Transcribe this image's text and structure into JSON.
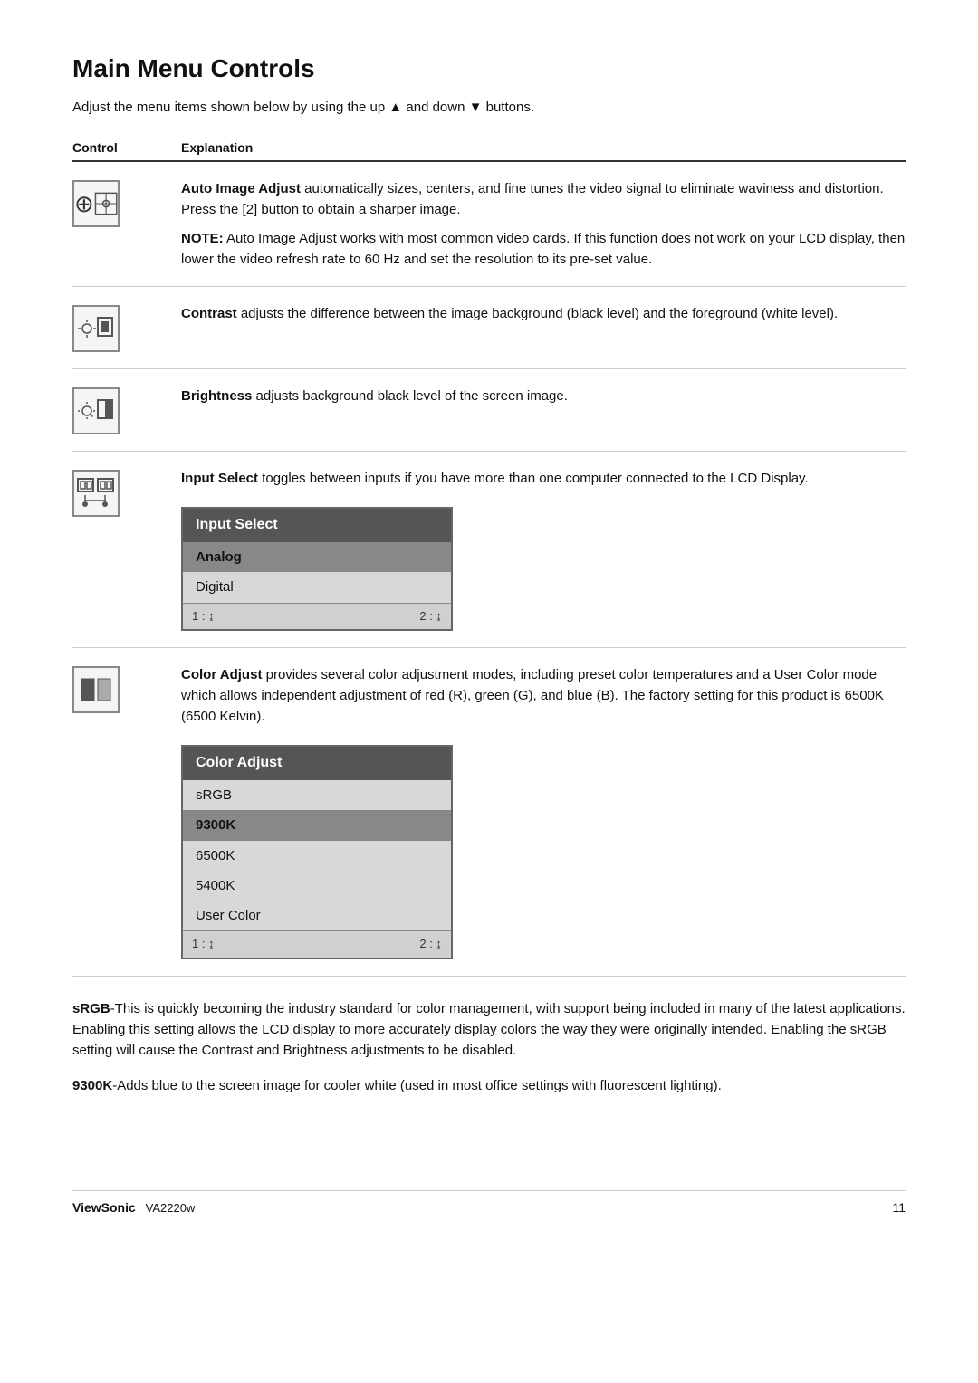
{
  "page": {
    "title": "Main Menu Controls",
    "intro": "Adjust the menu items shown below by using the up ▲ and down ▼ buttons.",
    "table": {
      "col1": "Control",
      "col2": "Explanation"
    },
    "rows": [
      {
        "id": "auto-image-adjust",
        "icon": "auto-image-icon",
        "text_parts": [
          "<strong>Auto Image Adjust</strong> automatically sizes, centers, and fine tunes the video signal to eliminate waviness and distortion. Press the [2] button to obtain a sharper image.",
          "<strong>NOTE:</strong> Auto Image Adjust works with most common video cards. If this function does not work on your LCD display, then lower the video refresh rate to 60 Hz and set the resolution to its pre-set value."
        ]
      },
      {
        "id": "contrast",
        "icon": "contrast-icon",
        "text_parts": [
          "<strong>Contrast</strong> adjusts the difference between the image background  (black level) and the foreground (white level)."
        ]
      },
      {
        "id": "brightness",
        "icon": "brightness-icon",
        "text_parts": [
          "<strong>Brightness</strong> adjusts background black level of the screen image."
        ]
      },
      {
        "id": "input-select",
        "icon": "input-select-icon",
        "text_parts": [
          "<strong>Input Select</strong> toggles between inputs if you have more than one computer connected to the LCD Display."
        ],
        "has_osd": "input-select"
      },
      {
        "id": "color-adjust",
        "icon": "color-adjust-icon",
        "text_parts": [
          "<strong>Color Adjust</strong> provides several color adjustment modes, including preset color temperatures and a User Color mode which allows independent adjustment of red (R), green (G), and blue (B). The factory setting for this product is 6500K (6500 Kelvin)."
        ],
        "has_osd": "color-adjust"
      }
    ],
    "osd_input_select": {
      "title": "Input Select",
      "items": [
        "Analog",
        "Digital"
      ],
      "selected": "Analog",
      "footer_left": "1 : ⇨",
      "footer_right": "2 : ⇨"
    },
    "osd_color_adjust": {
      "title": "Color Adjust",
      "items": [
        "sRGB",
        "9300K",
        "6500K",
        "5400K",
        "User Color"
      ],
      "selected": "9300K",
      "footer_left": "1 : ⇨",
      "footer_right": "2 : ⇨"
    },
    "extra_paragraphs": [
      "<strong>sRGB</strong>-This is quickly becoming the industry standard for color management, with support being included in many of the latest applications. Enabling this setting allows the LCD display to more accurately display colors the way they were originally intended. Enabling the sRGB setting will cause the Contrast and Brightness adjustments to be disabled.",
      "<strong>9300K</strong>-Adds blue to the screen image for cooler white (used in most office settings with fluorescent lighting)."
    ],
    "footer": {
      "brand": "ViewSonic",
      "model": "VA2220w",
      "page_number": "11"
    }
  }
}
